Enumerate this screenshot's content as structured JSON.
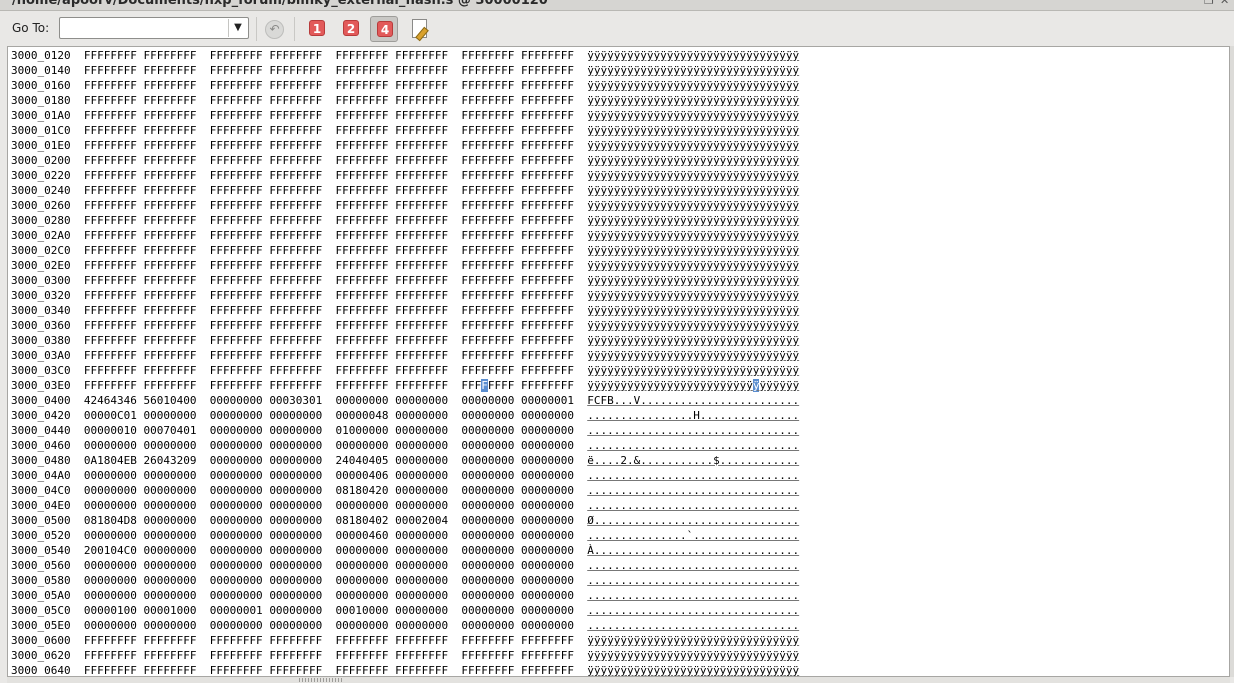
{
  "window": {
    "title": "/home/apoorv/Documents/nxp_forum/blinky_external_flash.s @ 30000120"
  },
  "toolbar": {
    "goto_label": "Go To:",
    "goto_value": "",
    "width_buttons": [
      {
        "label": "1",
        "active": false
      },
      {
        "label": "2",
        "active": false
      },
      {
        "label": "4",
        "active": true
      }
    ]
  },
  "memory_rows": [
    {
      "addr": "3000_0120",
      "w": [
        "FFFFFFFF",
        "FFFFFFFF",
        "FFFFFFFF",
        "FFFFFFFF",
        "FFFFFFFF",
        "FFFFFFFF",
        "FFFFFFFF",
        "FFFFFFFF"
      ],
      "ascii": "ÿÿÿÿÿÿÿÿÿÿÿÿÿÿÿÿÿÿÿÿÿÿÿÿÿÿÿÿÿÿÿÿ"
    },
    {
      "addr": "3000_0140",
      "w": [
        "FFFFFFFF",
        "FFFFFFFF",
        "FFFFFFFF",
        "FFFFFFFF",
        "FFFFFFFF",
        "FFFFFFFF",
        "FFFFFFFF",
        "FFFFFFFF"
      ],
      "ascii": "ÿÿÿÿÿÿÿÿÿÿÿÿÿÿÿÿÿÿÿÿÿÿÿÿÿÿÿÿÿÿÿÿ"
    },
    {
      "addr": "3000_0160",
      "w": [
        "FFFFFFFF",
        "FFFFFFFF",
        "FFFFFFFF",
        "FFFFFFFF",
        "FFFFFFFF",
        "FFFFFFFF",
        "FFFFFFFF",
        "FFFFFFFF"
      ],
      "ascii": "ÿÿÿÿÿÿÿÿÿÿÿÿÿÿÿÿÿÿÿÿÿÿÿÿÿÿÿÿÿÿÿÿ"
    },
    {
      "addr": "3000_0180",
      "w": [
        "FFFFFFFF",
        "FFFFFFFF",
        "FFFFFFFF",
        "FFFFFFFF",
        "FFFFFFFF",
        "FFFFFFFF",
        "FFFFFFFF",
        "FFFFFFFF"
      ],
      "ascii": "ÿÿÿÿÿÿÿÿÿÿÿÿÿÿÿÿÿÿÿÿÿÿÿÿÿÿÿÿÿÿÿÿ"
    },
    {
      "addr": "3000_01A0",
      "w": [
        "FFFFFFFF",
        "FFFFFFFF",
        "FFFFFFFF",
        "FFFFFFFF",
        "FFFFFFFF",
        "FFFFFFFF",
        "FFFFFFFF",
        "FFFFFFFF"
      ],
      "ascii": "ÿÿÿÿÿÿÿÿÿÿÿÿÿÿÿÿÿÿÿÿÿÿÿÿÿÿÿÿÿÿÿÿ"
    },
    {
      "addr": "3000_01C0",
      "w": [
        "FFFFFFFF",
        "FFFFFFFF",
        "FFFFFFFF",
        "FFFFFFFF",
        "FFFFFFFF",
        "FFFFFFFF",
        "FFFFFFFF",
        "FFFFFFFF"
      ],
      "ascii": "ÿÿÿÿÿÿÿÿÿÿÿÿÿÿÿÿÿÿÿÿÿÿÿÿÿÿÿÿÿÿÿÿ"
    },
    {
      "addr": "3000_01E0",
      "w": [
        "FFFFFFFF",
        "FFFFFFFF",
        "FFFFFFFF",
        "FFFFFFFF",
        "FFFFFFFF",
        "FFFFFFFF",
        "FFFFFFFF",
        "FFFFFFFF"
      ],
      "ascii": "ÿÿÿÿÿÿÿÿÿÿÿÿÿÿÿÿÿÿÿÿÿÿÿÿÿÿÿÿÿÿÿÿ"
    },
    {
      "addr": "3000_0200",
      "w": [
        "FFFFFFFF",
        "FFFFFFFF",
        "FFFFFFFF",
        "FFFFFFFF",
        "FFFFFFFF",
        "FFFFFFFF",
        "FFFFFFFF",
        "FFFFFFFF"
      ],
      "ascii": "ÿÿÿÿÿÿÿÿÿÿÿÿÿÿÿÿÿÿÿÿÿÿÿÿÿÿÿÿÿÿÿÿ"
    },
    {
      "addr": "3000_0220",
      "w": [
        "FFFFFFFF",
        "FFFFFFFF",
        "FFFFFFFF",
        "FFFFFFFF",
        "FFFFFFFF",
        "FFFFFFFF",
        "FFFFFFFF",
        "FFFFFFFF"
      ],
      "ascii": "ÿÿÿÿÿÿÿÿÿÿÿÿÿÿÿÿÿÿÿÿÿÿÿÿÿÿÿÿÿÿÿÿ"
    },
    {
      "addr": "3000_0240",
      "w": [
        "FFFFFFFF",
        "FFFFFFFF",
        "FFFFFFFF",
        "FFFFFFFF",
        "FFFFFFFF",
        "FFFFFFFF",
        "FFFFFFFF",
        "FFFFFFFF"
      ],
      "ascii": "ÿÿÿÿÿÿÿÿÿÿÿÿÿÿÿÿÿÿÿÿÿÿÿÿÿÿÿÿÿÿÿÿ"
    },
    {
      "addr": "3000_0260",
      "w": [
        "FFFFFFFF",
        "FFFFFFFF",
        "FFFFFFFF",
        "FFFFFFFF",
        "FFFFFFFF",
        "FFFFFFFF",
        "FFFFFFFF",
        "FFFFFFFF"
      ],
      "ascii": "ÿÿÿÿÿÿÿÿÿÿÿÿÿÿÿÿÿÿÿÿÿÿÿÿÿÿÿÿÿÿÿÿ"
    },
    {
      "addr": "3000_0280",
      "w": [
        "FFFFFFFF",
        "FFFFFFFF",
        "FFFFFFFF",
        "FFFFFFFF",
        "FFFFFFFF",
        "FFFFFFFF",
        "FFFFFFFF",
        "FFFFFFFF"
      ],
      "ascii": "ÿÿÿÿÿÿÿÿÿÿÿÿÿÿÿÿÿÿÿÿÿÿÿÿÿÿÿÿÿÿÿÿ"
    },
    {
      "addr": "3000_02A0",
      "w": [
        "FFFFFFFF",
        "FFFFFFFF",
        "FFFFFFFF",
        "FFFFFFFF",
        "FFFFFFFF",
        "FFFFFFFF",
        "FFFFFFFF",
        "FFFFFFFF"
      ],
      "ascii": "ÿÿÿÿÿÿÿÿÿÿÿÿÿÿÿÿÿÿÿÿÿÿÿÿÿÿÿÿÿÿÿÿ"
    },
    {
      "addr": "3000_02C0",
      "w": [
        "FFFFFFFF",
        "FFFFFFFF",
        "FFFFFFFF",
        "FFFFFFFF",
        "FFFFFFFF",
        "FFFFFFFF",
        "FFFFFFFF",
        "FFFFFFFF"
      ],
      "ascii": "ÿÿÿÿÿÿÿÿÿÿÿÿÿÿÿÿÿÿÿÿÿÿÿÿÿÿÿÿÿÿÿÿ"
    },
    {
      "addr": "3000_02E0",
      "w": [
        "FFFFFFFF",
        "FFFFFFFF",
        "FFFFFFFF",
        "FFFFFFFF",
        "FFFFFFFF",
        "FFFFFFFF",
        "FFFFFFFF",
        "FFFFFFFF"
      ],
      "ascii": "ÿÿÿÿÿÿÿÿÿÿÿÿÿÿÿÿÿÿÿÿÿÿÿÿÿÿÿÿÿÿÿÿ"
    },
    {
      "addr": "3000_0300",
      "w": [
        "FFFFFFFF",
        "FFFFFFFF",
        "FFFFFFFF",
        "FFFFFFFF",
        "FFFFFFFF",
        "FFFFFFFF",
        "FFFFFFFF",
        "FFFFFFFF"
      ],
      "ascii": "ÿÿÿÿÿÿÿÿÿÿÿÿÿÿÿÿÿÿÿÿÿÿÿÿÿÿÿÿÿÿÿÿ"
    },
    {
      "addr": "3000_0320",
      "w": [
        "FFFFFFFF",
        "FFFFFFFF",
        "FFFFFFFF",
        "FFFFFFFF",
        "FFFFFFFF",
        "FFFFFFFF",
        "FFFFFFFF",
        "FFFFFFFF"
      ],
      "ascii": "ÿÿÿÿÿÿÿÿÿÿÿÿÿÿÿÿÿÿÿÿÿÿÿÿÿÿÿÿÿÿÿÿ"
    },
    {
      "addr": "3000_0340",
      "w": [
        "FFFFFFFF",
        "FFFFFFFF",
        "FFFFFFFF",
        "FFFFFFFF",
        "FFFFFFFF",
        "FFFFFFFF",
        "FFFFFFFF",
        "FFFFFFFF"
      ],
      "ascii": "ÿÿÿÿÿÿÿÿÿÿÿÿÿÿÿÿÿÿÿÿÿÿÿÿÿÿÿÿÿÿÿÿ"
    },
    {
      "addr": "3000_0360",
      "w": [
        "FFFFFFFF",
        "FFFFFFFF",
        "FFFFFFFF",
        "FFFFFFFF",
        "FFFFFFFF",
        "FFFFFFFF",
        "FFFFFFFF",
        "FFFFFFFF"
      ],
      "ascii": "ÿÿÿÿÿÿÿÿÿÿÿÿÿÿÿÿÿÿÿÿÿÿÿÿÿÿÿÿÿÿÿÿ"
    },
    {
      "addr": "3000_0380",
      "w": [
        "FFFFFFFF",
        "FFFFFFFF",
        "FFFFFFFF",
        "FFFFFFFF",
        "FFFFFFFF",
        "FFFFFFFF",
        "FFFFFFFF",
        "FFFFFFFF"
      ],
      "ascii": "ÿÿÿÿÿÿÿÿÿÿÿÿÿÿÿÿÿÿÿÿÿÿÿÿÿÿÿÿÿÿÿÿ"
    },
    {
      "addr": "3000_03A0",
      "w": [
        "FFFFFFFF",
        "FFFFFFFF",
        "FFFFFFFF",
        "FFFFFFFF",
        "FFFFFFFF",
        "FFFFFFFF",
        "FFFFFFFF",
        "FFFFFFFF"
      ],
      "ascii": "ÿÿÿÿÿÿÿÿÿÿÿÿÿÿÿÿÿÿÿÿÿÿÿÿÿÿÿÿÿÿÿÿ"
    },
    {
      "addr": "3000_03C0",
      "w": [
        "FFFFFFFF",
        "FFFFFFFF",
        "FFFFFFFF",
        "FFFFFFFF",
        "FFFFFFFF",
        "FFFFFFFF",
        "FFFFFFFF",
        "FFFFFFFF"
      ],
      "ascii": "ÿÿÿÿÿÿÿÿÿÿÿÿÿÿÿÿÿÿÿÿÿÿÿÿÿÿÿÿÿÿÿÿ"
    },
    {
      "addr": "3000_03E0",
      "w": [
        "FFFFFFFF",
        "FFFFFFFF",
        "FFFFFFFF",
        "FFFFFFFF",
        "FFFFFFFF",
        "FFFFFFFF",
        "FFFFFFFF",
        "FFFFFFFF"
      ],
      "ascii": "ÿÿÿÿÿÿÿÿÿÿÿÿÿÿÿÿÿÿÿÿÿÿÿÿÿÿÿÿÿÿÿÿ",
      "selected_word": 6,
      "selected_nibble": 3,
      "selected_ascii": 25
    },
    {
      "addr": "3000_0400",
      "w": [
        "42464346",
        "56010400",
        "00000000",
        "00030301",
        "00000000",
        "00000000",
        "00000000",
        "00000001"
      ],
      "ascii": "FCFB...V........................"
    },
    {
      "addr": "3000_0420",
      "w": [
        "00000C01",
        "00000000",
        "00000000",
        "00000000",
        "00000048",
        "00000000",
        "00000000",
        "00000000"
      ],
      "ascii": "................H..............."
    },
    {
      "addr": "3000_0440",
      "w": [
        "00000010",
        "00070401",
        "00000000",
        "00000000",
        "01000000",
        "00000000",
        "00000000",
        "00000000"
      ],
      "ascii": "................................"
    },
    {
      "addr": "3000_0460",
      "w": [
        "00000000",
        "00000000",
        "00000000",
        "00000000",
        "00000000",
        "00000000",
        "00000000",
        "00000000"
      ],
      "ascii": "................................"
    },
    {
      "addr": "3000_0480",
      "w": [
        "0A1804EB",
        "26043209",
        "00000000",
        "00000000",
        "24040405",
        "00000000",
        "00000000",
        "00000000"
      ],
      "ascii": "ë....2.&...........$............"
    },
    {
      "addr": "3000_04A0",
      "w": [
        "00000000",
        "00000000",
        "00000000",
        "00000000",
        "00000406",
        "00000000",
        "00000000",
        "00000000"
      ],
      "ascii": "................................"
    },
    {
      "addr": "3000_04C0",
      "w": [
        "00000000",
        "00000000",
        "00000000",
        "00000000",
        "08180420",
        "00000000",
        "00000000",
        "00000000"
      ],
      "ascii": "................................"
    },
    {
      "addr": "3000_04E0",
      "w": [
        "00000000",
        "00000000",
        "00000000",
        "00000000",
        "00000000",
        "00000000",
        "00000000",
        "00000000"
      ],
      "ascii": "................................"
    },
    {
      "addr": "3000_0500",
      "w": [
        "081804D8",
        "00000000",
        "00000000",
        "00000000",
        "08180402",
        "00002004",
        "00000000",
        "00000000"
      ],
      "ascii": "Ø..............................."
    },
    {
      "addr": "3000_0520",
      "w": [
        "00000000",
        "00000000",
        "00000000",
        "00000000",
        "00000460",
        "00000000",
        "00000000",
        "00000000"
      ],
      "ascii": "...............`................"
    },
    {
      "addr": "3000_0540",
      "w": [
        "200104C0",
        "00000000",
        "00000000",
        "00000000",
        "00000000",
        "00000000",
        "00000000",
        "00000000"
      ],
      "ascii": "À..............................."
    },
    {
      "addr": "3000_0560",
      "w": [
        "00000000",
        "00000000",
        "00000000",
        "00000000",
        "00000000",
        "00000000",
        "00000000",
        "00000000"
      ],
      "ascii": "................................"
    },
    {
      "addr": "3000_0580",
      "w": [
        "00000000",
        "00000000",
        "00000000",
        "00000000",
        "00000000",
        "00000000",
        "00000000",
        "00000000"
      ],
      "ascii": "................................"
    },
    {
      "addr": "3000_05A0",
      "w": [
        "00000000",
        "00000000",
        "00000000",
        "00000000",
        "00000000",
        "00000000",
        "00000000",
        "00000000"
      ],
      "ascii": "................................"
    },
    {
      "addr": "3000_05C0",
      "w": [
        "00000100",
        "00001000",
        "00000001",
        "00000000",
        "00010000",
        "00000000",
        "00000000",
        "00000000"
      ],
      "ascii": "................................"
    },
    {
      "addr": "3000_05E0",
      "w": [
        "00000000",
        "00000000",
        "00000000",
        "00000000",
        "00000000",
        "00000000",
        "00000000",
        "00000000"
      ],
      "ascii": "................................"
    },
    {
      "addr": "3000_0600",
      "w": [
        "FFFFFFFF",
        "FFFFFFFF",
        "FFFFFFFF",
        "FFFFFFFF",
        "FFFFFFFF",
        "FFFFFFFF",
        "FFFFFFFF",
        "FFFFFFFF"
      ],
      "ascii": "ÿÿÿÿÿÿÿÿÿÿÿÿÿÿÿÿÿÿÿÿÿÿÿÿÿÿÿÿÿÿÿÿ"
    },
    {
      "addr": "3000_0620",
      "w": [
        "FFFFFFFF",
        "FFFFFFFF",
        "FFFFFFFF",
        "FFFFFFFF",
        "FFFFFFFF",
        "FFFFFFFF",
        "FFFFFFFF",
        "FFFFFFFF"
      ],
      "ascii": "ÿÿÿÿÿÿÿÿÿÿÿÿÿÿÿÿÿÿÿÿÿÿÿÿÿÿÿÿÿÿÿÿ"
    },
    {
      "addr": "3000_0640",
      "w": [
        "FFFFFFFF",
        "FFFFFFFF",
        "FFFFFFFF",
        "FFFFFFFF",
        "FFFFFFFF",
        "FFFFFFFF",
        "FFFFFFFF",
        "FFFFFFFF"
      ],
      "ascii": "ÿÿÿÿÿÿÿÿÿÿÿÿÿÿÿÿÿÿÿÿÿÿÿÿÿÿÿÿÿÿÿÿ"
    }
  ]
}
